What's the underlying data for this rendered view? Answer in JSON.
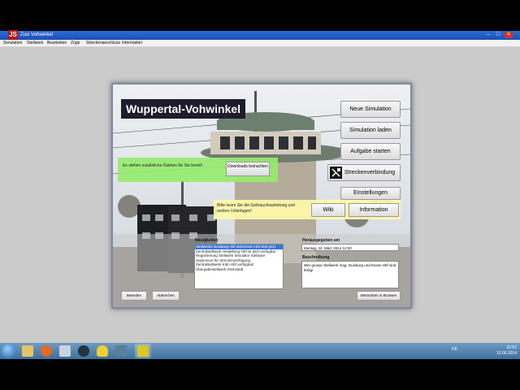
{
  "app": {
    "title": "Zusi Vohwinkel",
    "logo": "JS",
    "menu": [
      "Simulation",
      "Stellwerk",
      "Bearbeiten",
      "Züge",
      "Streckenanschluss",
      "Information"
    ]
  },
  "launcher": {
    "place_title": "Wuppertal-Vohwinkel",
    "side_buttons": {
      "new_sim": "Neue Simulation",
      "load_sim": "Simulation laden",
      "task": "Aufgabe starten",
      "strecke": "Streckenverbindung",
      "settings": "Einstellungen"
    },
    "downloads": {
      "text": "Es stehen zusätzliche Dateien für Sie bereit!",
      "button": "Downloads betrachten"
    },
    "docs": {
      "text": "Bitte lesen Sie die Gebrauchsanleitung und andere Unterlagen!",
      "wiki": "Wiki",
      "info": "Information"
    },
    "news": {
      "label": "Neuigkeiten",
      "items": [
        "Stellwerke Duisburg Hbf und Essen Hbf sind jetzt",
        "Zentralstellwerk Heidelberg Hbf ist jetzt verfügbar",
        "Registrierung Stellwerk Simulator Software",
        "Supervisor für Streckenverfügung",
        "Zentralstellwerk Köln Hbf verfügbar!",
        "Übergabestellwerk Kleinstadt"
      ]
    },
    "release": {
      "label": "Herausgegeben am",
      "value": "Montag, 24. März 2014 12:00"
    },
    "description": {
      "label": "Beschreibung",
      "value": "Wer grosse Stellwerk mag: Duisburg und Essen Hbf sind fertig!"
    },
    "buttons": {
      "close": "Beenden",
      "cancel": "Abbrechen",
      "browser": "Betrachten in Browser"
    }
  },
  "taskbar": {
    "lang": "DE",
    "time": "22:52",
    "date": "10.06.2014"
  },
  "colors": {
    "title_bg": "#1f1c2e",
    "downloads_panel": "#96eb6e",
    "docs_panel": "#fffaaa",
    "selection": "#3b76d6"
  }
}
